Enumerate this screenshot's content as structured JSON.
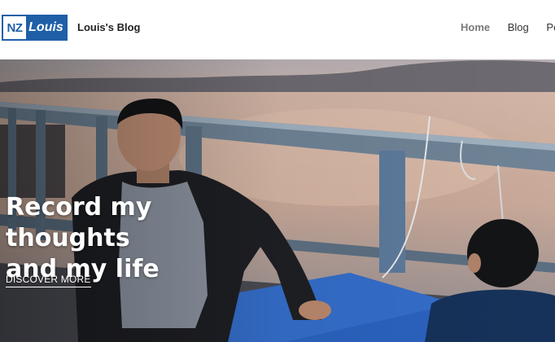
{
  "header": {
    "logo_left": "NZ",
    "logo_right": "Louis",
    "site_title": "Louis's Blog",
    "nav": [
      {
        "label": "Home",
        "active": true
      },
      {
        "label": "Blog",
        "active": false
      },
      {
        "label": "Po",
        "active": false
      }
    ]
  },
  "hero": {
    "heading_line1": "Record my thoughts",
    "heading_line2": "and my life",
    "cta_label": "DISCOVER MORE"
  },
  "colors": {
    "brand": "#1f5fa8",
    "nav_active": "#7a7a7a",
    "nav_text": "#333333"
  }
}
